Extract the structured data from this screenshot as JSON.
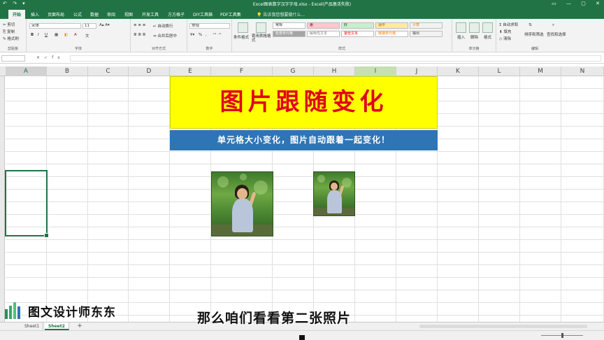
{
  "window": {
    "title": "Excel图表数字汉字字母.xlsx - Excel(产品激活失败)"
  },
  "quick_access": "↶ ↷ ▾",
  "window_controls": [
    "▭",
    "—",
    "▢",
    "✕"
  ],
  "ribbon_tabs": [
    "开始",
    "插入",
    "页面布局",
    "公式",
    "数据",
    "审阅",
    "视图",
    "开发工具",
    "方方格子",
    "DIY工具箱",
    "PDF工具集"
  ],
  "active_tab": "开始",
  "tell_me": "告诉我您想要做什么...",
  "ribbon": {
    "clipboard": {
      "cut": "剪切",
      "copy": "复制",
      "format_painter": "格式刷",
      "group": "剪贴板"
    },
    "font": {
      "name": "宋体",
      "size": "11",
      "bold": "B",
      "italic": "I",
      "underline": "U",
      "group": "字体"
    },
    "alignment": {
      "wrap": "自动换行",
      "merge": "合并后居中",
      "group": "对齐方式"
    },
    "number": {
      "format": "常规",
      "percent": "%",
      "comma": ",",
      "group": "数字"
    },
    "styles": {
      "conditional": "条件格式",
      "table": "套用表格格式",
      "group": "样式",
      "gallery": [
        {
          "label": "常规",
          "bg": "#ffffff",
          "fg": "#222222"
        },
        {
          "label": "差",
          "bg": "#ffc7ce",
          "fg": "#9c0006"
        },
        {
          "label": "好",
          "bg": "#c6efce",
          "fg": "#006100"
        },
        {
          "label": "适中",
          "bg": "#ffeb9c",
          "fg": "#9c5700"
        },
        {
          "label": "计算",
          "bg": "#f2f2f2",
          "fg": "#fa7d00"
        },
        {
          "label": "检查单元格",
          "bg": "#a5a5a5",
          "fg": "#ffffff"
        },
        {
          "label": "解释性文本",
          "bg": "#ffffff",
          "fg": "#7f7f7f"
        },
        {
          "label": "警告文本",
          "bg": "#ffffff",
          "fg": "#ff0000"
        },
        {
          "label": "链接单元格",
          "bg": "#ffffff",
          "fg": "#fa7d00"
        },
        {
          "label": "输出",
          "bg": "#f2f2f2",
          "fg": "#3f3f3f"
        }
      ]
    },
    "cells": {
      "insert": "插入",
      "delete": "删除",
      "format": "格式",
      "group": "单元格"
    },
    "editing": {
      "autosum": "自动求和",
      "fill": "填充",
      "clear": "清除",
      "sort": "排序和筛选",
      "find": "查找和选择",
      "group": "编辑"
    }
  },
  "formula_bar": {
    "cancel": "✕",
    "enter": "✓",
    "fx": "fx"
  },
  "columns": [
    "A",
    "B",
    "C",
    "D",
    "E",
    "F",
    "G",
    "H",
    "I",
    "J",
    "K",
    "L",
    "M",
    "N"
  ],
  "banner": {
    "title": "图片跟随变化",
    "subtitle": "单元格大小变化，图片自动跟着一起变化！",
    "title_bg": "#ffff00",
    "title_color": "#e0001b",
    "subtitle_bg": "#2e75b6"
  },
  "sheets": [
    "Sheet1",
    "Sheet2"
  ],
  "active_sheet": "Sheet2",
  "add_sheet": "+",
  "overlay": {
    "watermark": "图文设计师东东",
    "subtitle": "那么咱们看看第二张照片"
  },
  "colors": {
    "accent": "#217346"
  }
}
